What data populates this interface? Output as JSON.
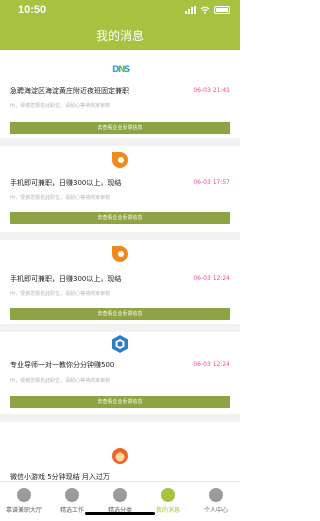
{
  "status_bar": {
    "time": "10:50"
  },
  "header": {
    "title": "我的消息"
  },
  "messages": [
    {
      "logo": "dns-logo-icon",
      "title": "急聘海淀区海淀黄庄附近夜班固定兼职",
      "time": "06-03 21:41",
      "desc": "Hi，很谢您报名此职位，请耐心等待商家审核",
      "button": "去查看企业反馈信息"
    },
    {
      "logo": "orange-bubble-logo-icon",
      "title": "手机即可兼职，日赚300以上，现结",
      "time": "06-03 17:57",
      "desc": "Hi，很谢您报名此职位，请耐心等待商家审核",
      "button": "去查看企业反馈信息"
    },
    {
      "logo": "orange-bubble-logo-icon",
      "title": "手机即可兼职，日赚300以上，现结",
      "time": "06-03 12:24",
      "desc": "Hi，很谢您报名此职位，请耐心等待商家审核",
      "button": "去查看企业反馈信息"
    },
    {
      "logo": "blue-cube-logo-icon",
      "title": "专业导师一对一教你分分钟赚500",
      "time": "06-03 12:24",
      "desc": "Hi，很谢您报名此职位，请耐心等待商家审核",
      "button": "去查看企业反馈信息"
    },
    {
      "logo": "orange-ring-logo-icon",
      "title": "微信小游戏 5分钟现结 月入过万",
      "time": "",
      "desc": "",
      "button": ""
    }
  ],
  "tabs": [
    {
      "label": "靠谱兼职大厅",
      "icon": "home-icon",
      "active": false
    },
    {
      "label": "精选工作",
      "icon": "check-icon",
      "active": false
    },
    {
      "label": "精选分类",
      "icon": "person-icon",
      "active": false
    },
    {
      "label": "我的消息",
      "icon": "message-icon",
      "active": true
    },
    {
      "label": "个人中心",
      "icon": "user-icon",
      "active": false
    }
  ]
}
